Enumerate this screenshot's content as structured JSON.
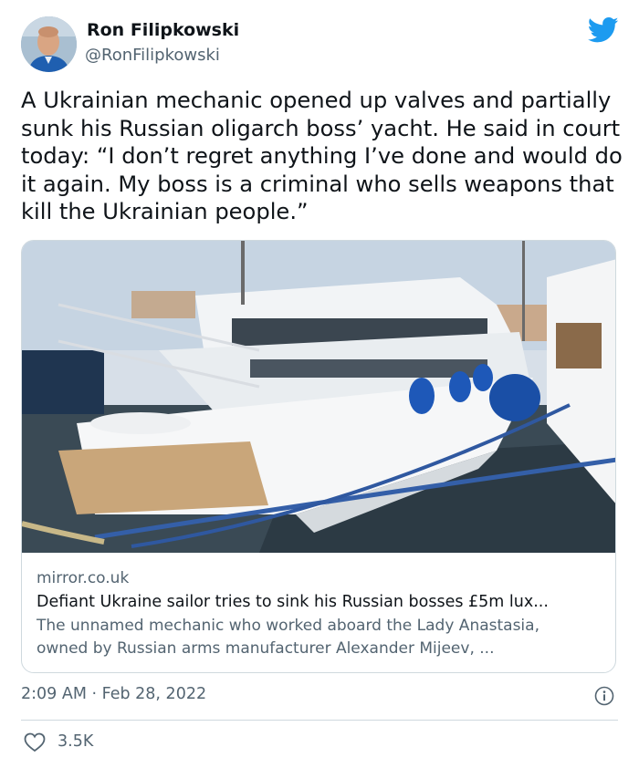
{
  "author": {
    "name": "Ron Filipkowski",
    "handle": "@RonFilipkowski",
    "avatar_icon": "avatar-photo"
  },
  "brand_icon": "twitter-bird-icon",
  "colors": {
    "brand_blue": "#1d9bf0",
    "text_primary": "#0f1419",
    "text_secondary": "#536471",
    "border": "#cfd9de"
  },
  "tweet": {
    "text": "A Ukrainian mechanic opened up valves and partially sunk his Russian oligarch boss’ yacht. He said in court today: “I don’t regret anything I’ve done and would do it again. My boss is a criminal who sells weapons that kill the Ukrainian people.”"
  },
  "card": {
    "domain": "mirror.co.uk",
    "title": "Defiant Ukraine sailor tries to sink his Russian bosses £5m lux...",
    "description_line1": "The unnamed mechanic who worked aboard the Lady Anastasia,",
    "description_line2": "owned by Russian arms manufacturer Alexander Mijeev, ...",
    "image_subject": "yacht-photo"
  },
  "meta": {
    "timestamp": "2:09 AM · Feb 28, 2022",
    "info_icon": "info-icon"
  },
  "engagement": {
    "likes": "3.5K",
    "like_icon": "heart-icon"
  }
}
